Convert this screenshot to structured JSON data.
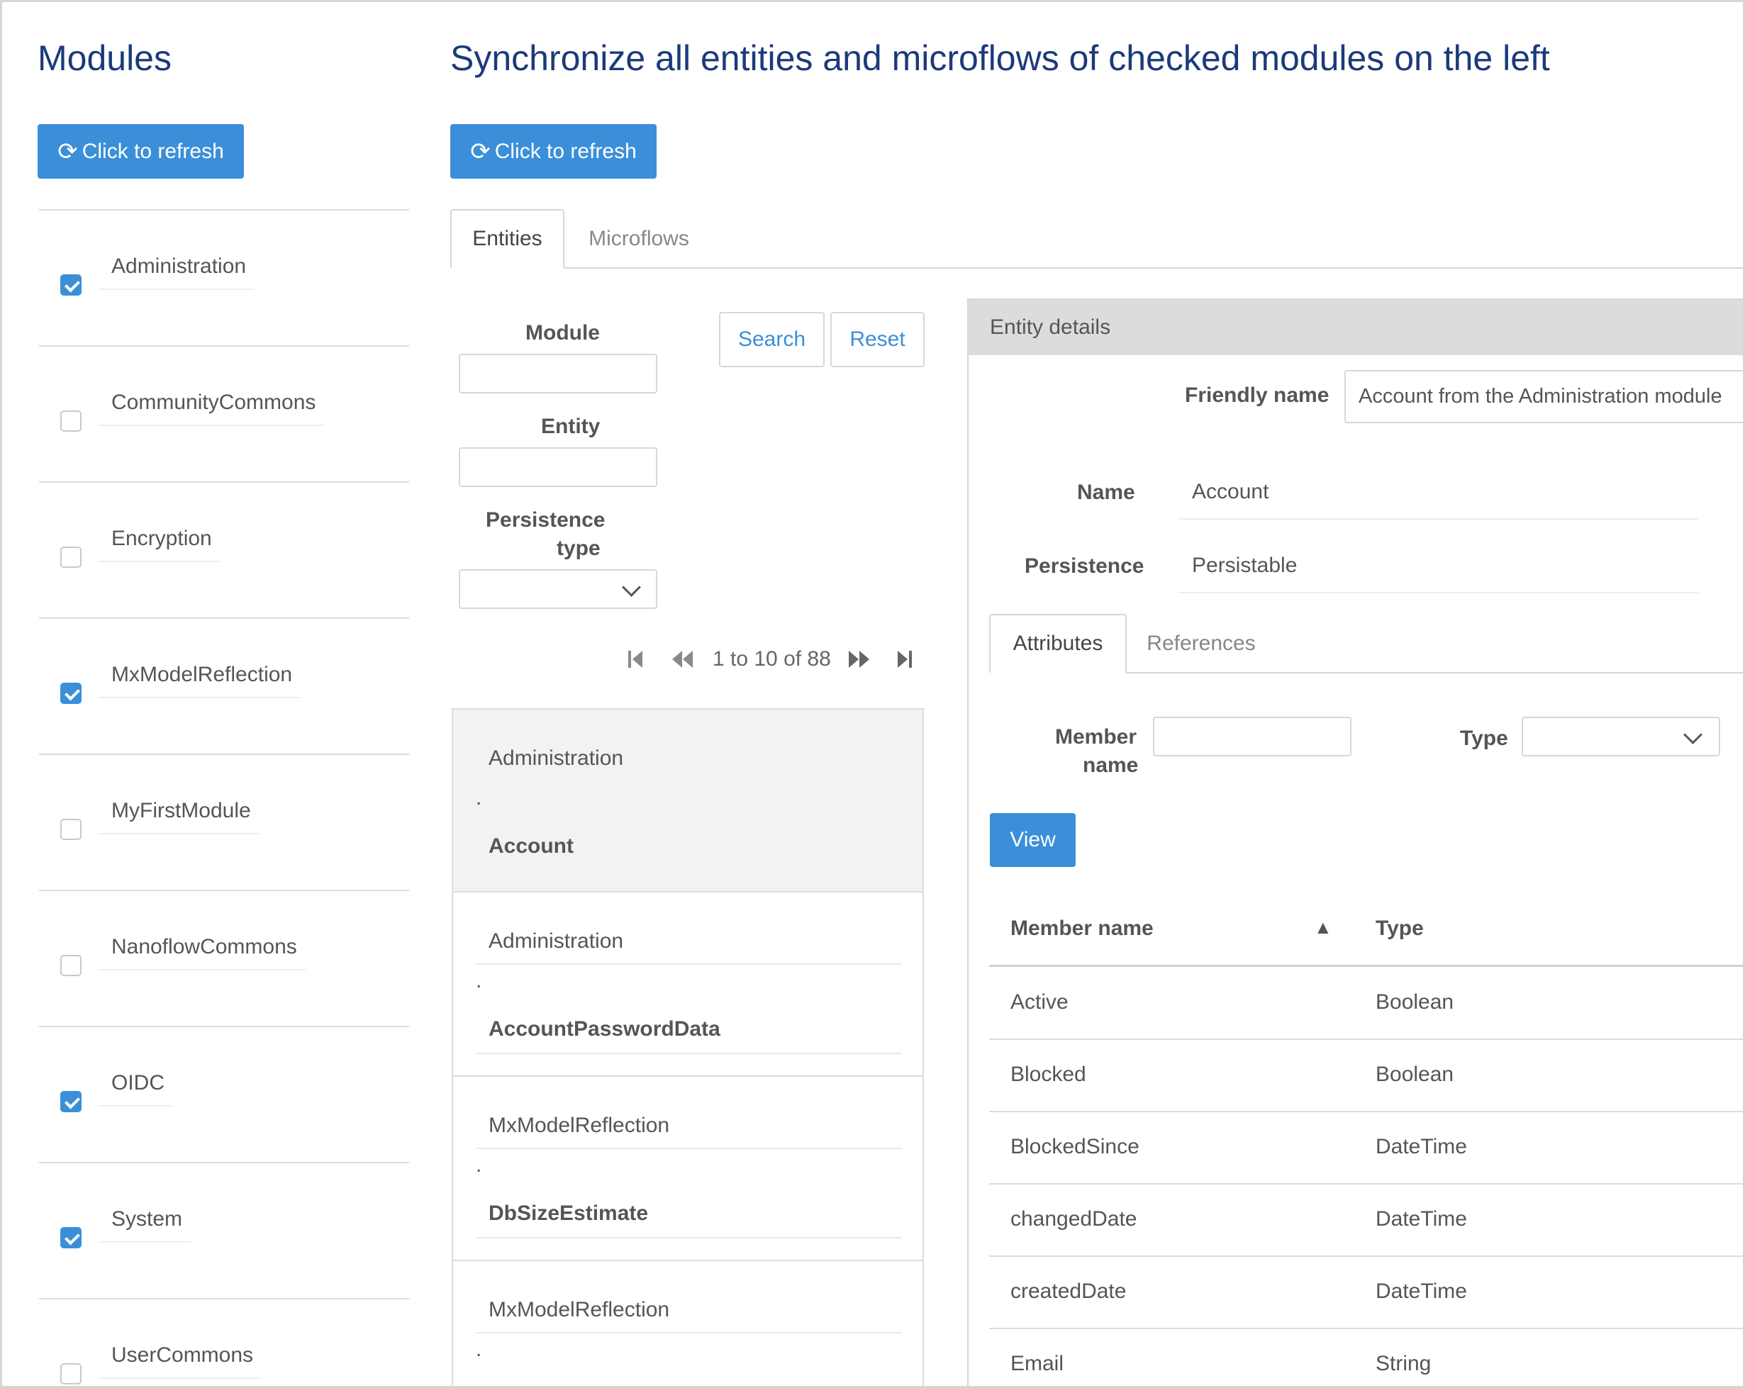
{
  "modules_panel": {
    "title": "Modules",
    "refresh_label": "Click to refresh",
    "items": [
      {
        "label": "Administration",
        "checked": true
      },
      {
        "label": "CommunityCommons",
        "checked": false
      },
      {
        "label": "Encryption",
        "checked": false
      },
      {
        "label": "MxModelReflection",
        "checked": true
      },
      {
        "label": "MyFirstModule",
        "checked": false
      },
      {
        "label": "NanoflowCommons",
        "checked": false
      },
      {
        "label": "OIDC",
        "checked": true
      },
      {
        "label": "System",
        "checked": true
      },
      {
        "label": "UserCommons",
        "checked": false
      }
    ]
  },
  "sync_panel": {
    "title": "Synchronize all entities and microflows of checked modules on the left",
    "refresh_label": "Click to refresh",
    "tabs": [
      {
        "label": "Entities",
        "active": true
      },
      {
        "label": "Microflows",
        "active": false
      }
    ]
  },
  "search_form": {
    "module_label": "Module",
    "module_value": "",
    "entity_label": "Entity",
    "entity_value": "",
    "persistence_label_1": "Persistence",
    "persistence_label_2": "type",
    "persistence_value": "",
    "search_label": "Search",
    "reset_label": "Reset"
  },
  "pagination": {
    "summary": "1 to 10 of 88"
  },
  "entity_list": [
    {
      "module": "Administration",
      "separator": ".",
      "entity": "Account",
      "selected": true
    },
    {
      "module": "Administration",
      "separator": ".",
      "entity": "AccountPasswordData",
      "selected": false
    },
    {
      "module": "MxModelReflection",
      "separator": ".",
      "entity": "DbSizeEstimate",
      "selected": false
    },
    {
      "module": "MxModelReflection",
      "separator": ".",
      "entity": "",
      "selected": false
    }
  ],
  "entity_details": {
    "header": "Entity details",
    "friendly_name_label": "Friendly name",
    "friendly_name_value": "Account from the Administration module",
    "name_label": "Name",
    "name_value": "Account",
    "persistence_label": "Persistence",
    "persistence_value": "Persistable",
    "tabs": [
      {
        "label": "Attributes",
        "active": true
      },
      {
        "label": "References",
        "active": false
      }
    ],
    "member_name_label_1": "Member",
    "member_name_label_2": "name",
    "member_name_value": "",
    "type_label": "Type",
    "type_value": "",
    "view_label": "View",
    "table": {
      "headers": {
        "member_name": "Member name",
        "sort": "▲",
        "type": "Type"
      },
      "rows": [
        {
          "member": "Active",
          "type": "Boolean"
        },
        {
          "member": "Blocked",
          "type": "Boolean"
        },
        {
          "member": "BlockedSince",
          "type": "DateTime"
        },
        {
          "member": "changedDate",
          "type": "DateTime"
        },
        {
          "member": "createdDate",
          "type": "DateTime"
        },
        {
          "member": "Email",
          "type": "String"
        }
      ]
    }
  },
  "colors": {
    "primary": "#3b8fd8",
    "title": "#1b3a7a",
    "border": "#d6d6d6",
    "selected_row": "#f2f2f2",
    "panel_header": "#dcdcdc"
  },
  "icons": {
    "refresh": "refresh-icon",
    "first": "first-page-icon",
    "prev": "previous-page-icon",
    "next": "next-page-icon",
    "last": "last-page-icon",
    "chevron": "chevron-down-icon"
  }
}
